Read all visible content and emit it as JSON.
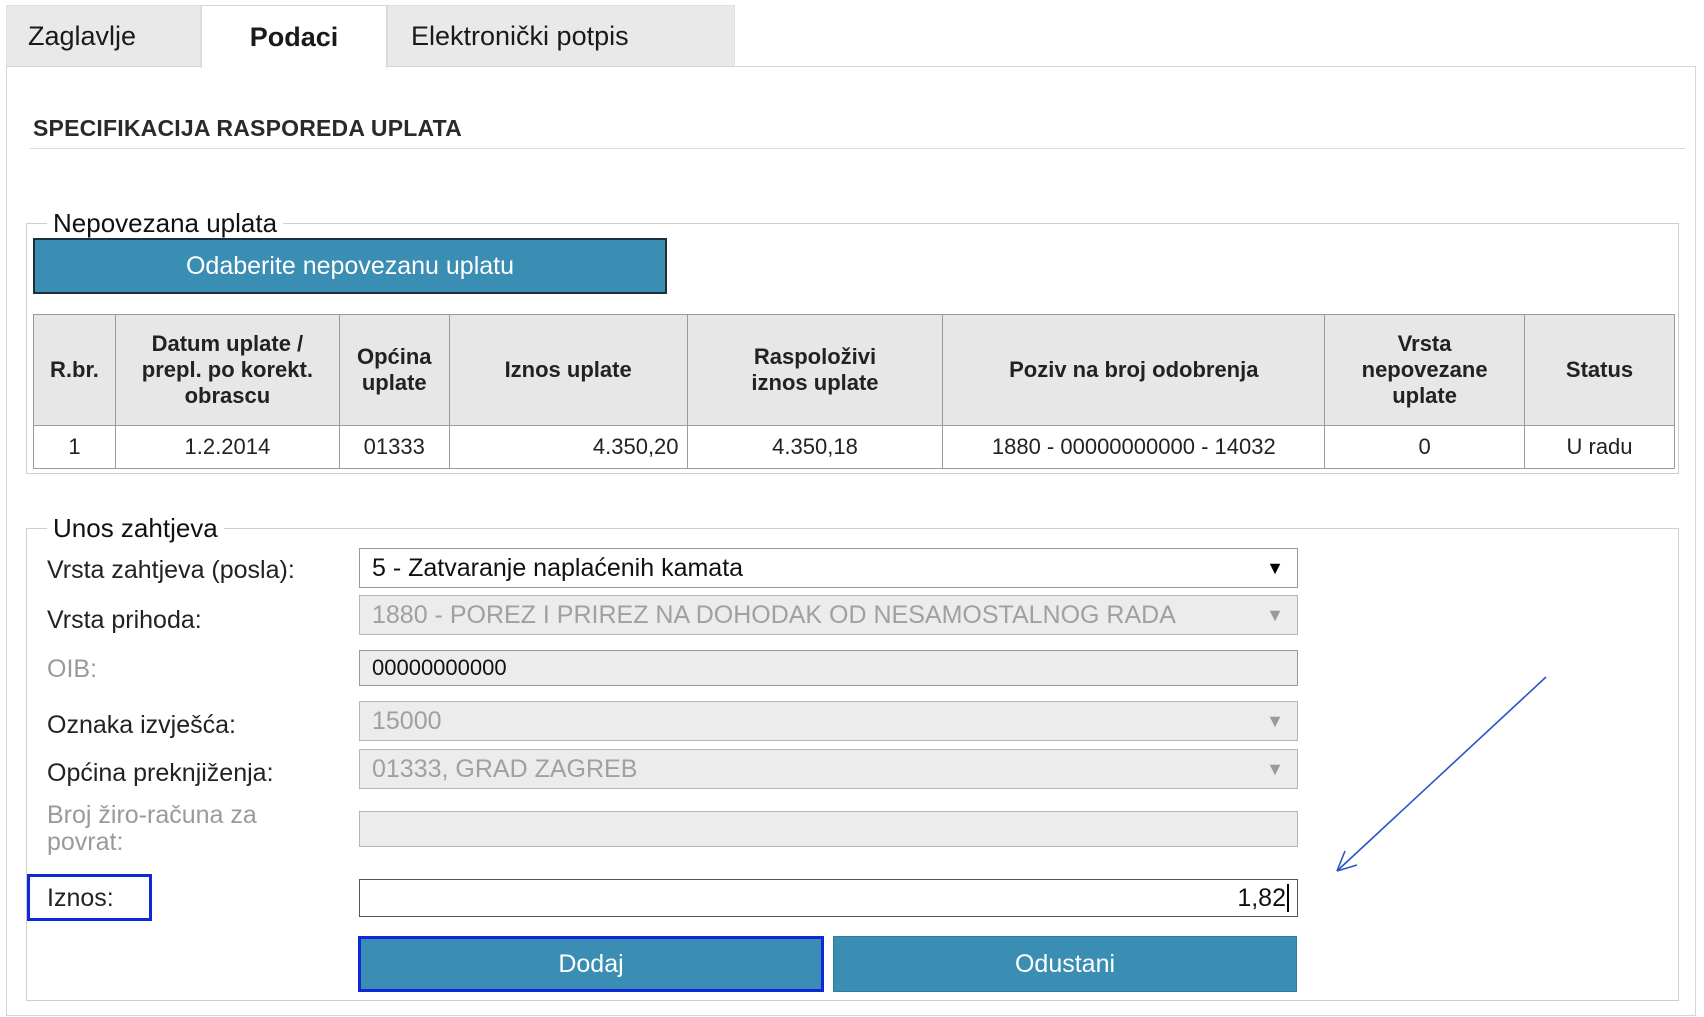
{
  "tabs": [
    {
      "label": "Zaglavlje",
      "active": false
    },
    {
      "label": "Podaci",
      "active": true
    },
    {
      "label": "Elektronički potpis",
      "active": false
    }
  ],
  "section_title": "SPECIFIKACIJA RASPOREDA UPLATA",
  "unlinked_payment": {
    "legend": "Nepovezana uplata",
    "select_button": "Odaberite nepovezanu uplatu",
    "table": {
      "headers": [
        "R.br.",
        "Datum uplate / prepl. po korekt. obrascu",
        "Općina uplate",
        "Iznos uplate",
        "Raspoloživi iznos uplate",
        "Poziv na broj odobrenja",
        "Vrsta nepovezane uplate",
        "Status"
      ],
      "rows": [
        [
          "1",
          "1.2.2014",
          "01333",
          "4.350,20",
          "4.350,18",
          "1880 - 00000000000 - 14032",
          "0",
          "U radu"
        ]
      ]
    }
  },
  "request_entry": {
    "legend": "Unos zahtjeva",
    "request_type_label": "Vrsta zahtjeva (posla):",
    "request_type_value": "5 - Zatvaranje naplaćenih kamata",
    "income_type_label": "Vrsta prihoda:",
    "income_type_value": "1880 - POREZ I PRIREZ NA DOHODAK OD NESAMOSTALNOG RADA",
    "oib_label": "OIB:",
    "oib_value": "00000000000",
    "report_mark_label": "Oznaka izvješća:",
    "report_mark_value": "15000",
    "municipality_label": "Općina preknjiženja:",
    "municipality_value": "01333, GRAD ZAGREB",
    "giro_account_label_line1": "Broj žiro-računa za",
    "giro_account_label_line2": "povrat:",
    "giro_account_value": "",
    "amount_label": "Iznos:",
    "amount_value": "1,82",
    "add_button": "Dodaj",
    "cancel_button": "Odustani"
  },
  "colors": {
    "button_blue": "#3a8db3",
    "highlight_blue": "#1029d8",
    "tab_inactive": "#e9e9e9",
    "disabled_field": "#ececec"
  },
  "icons": {
    "dropdown": "chevron-down-icon",
    "annotation": "arrow-annotation-icon"
  }
}
